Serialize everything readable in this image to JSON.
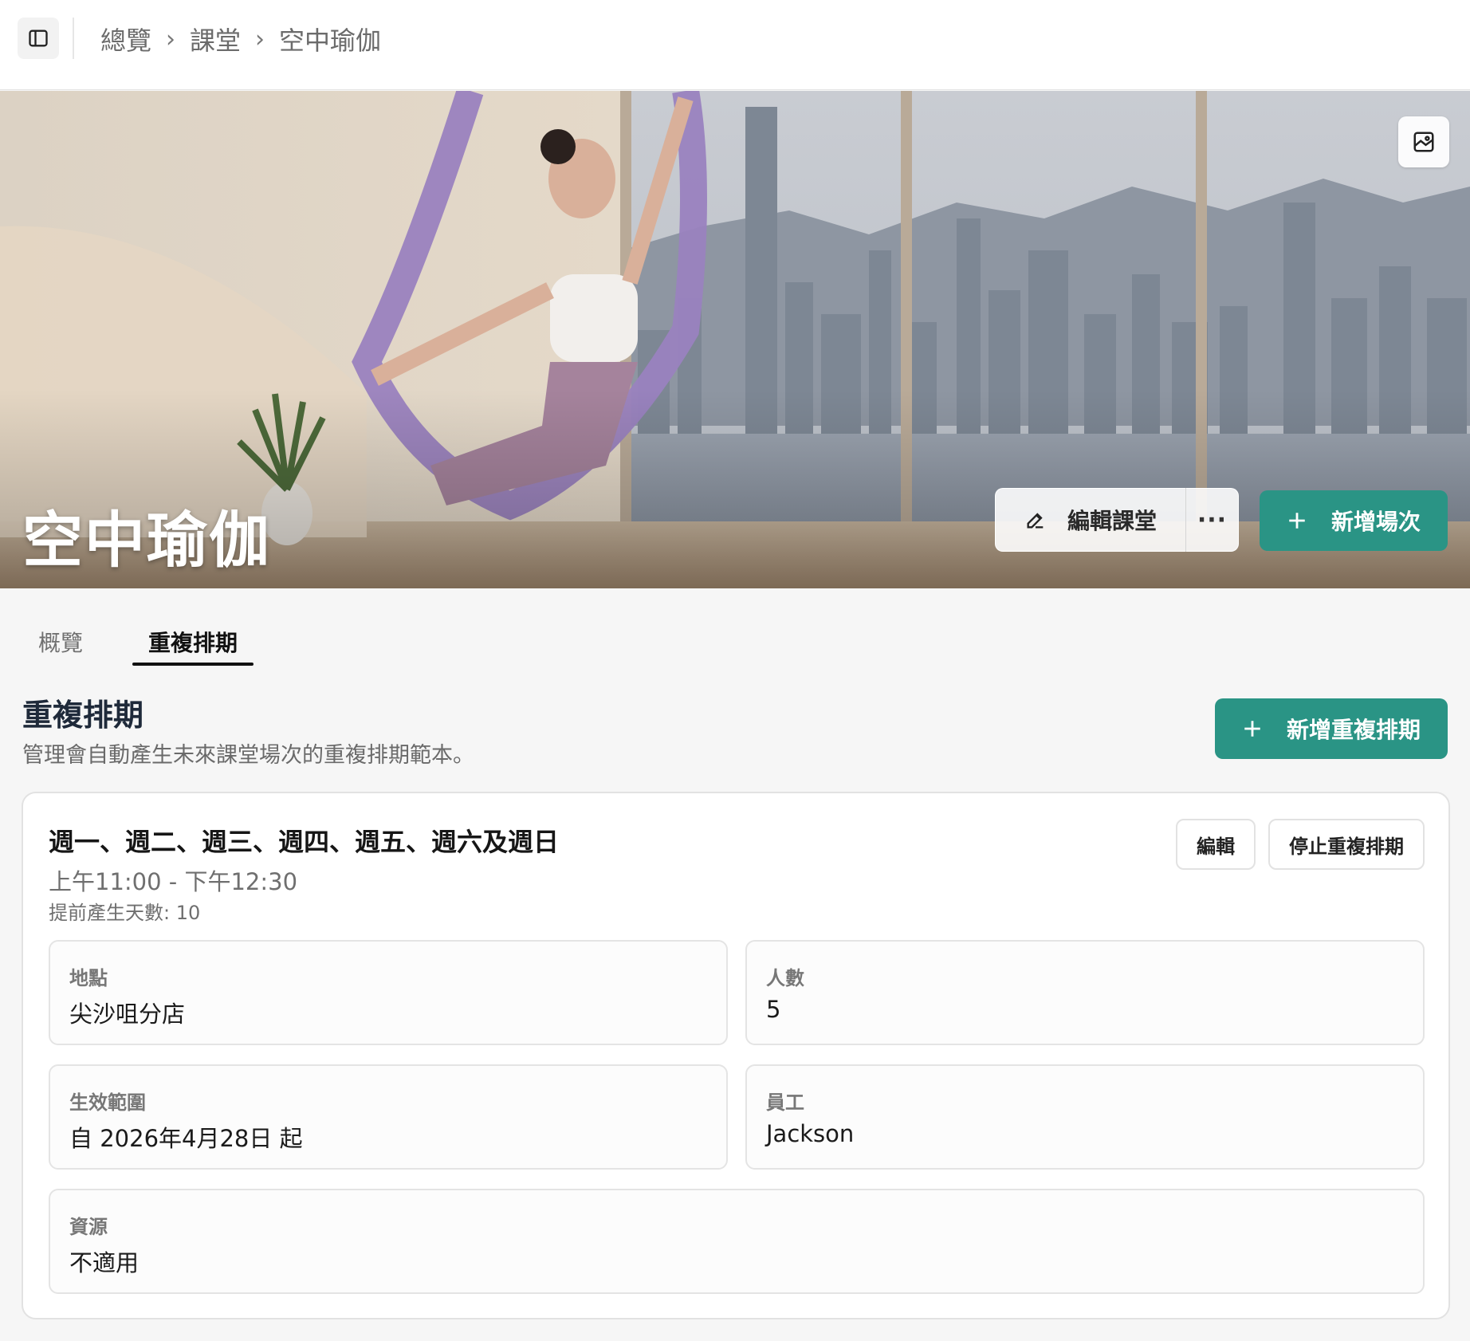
{
  "breadcrumb": {
    "items": [
      "總覽",
      "課堂",
      "空中瑜伽"
    ]
  },
  "hero": {
    "title": "空中瑜伽",
    "edit_label": "編輯課堂",
    "more_label": "···",
    "add_session_label": "新增場次"
  },
  "tabs": [
    {
      "label": "概覽"
    },
    {
      "label": "重複排期"
    }
  ],
  "section": {
    "title": "重複排期",
    "description": "管理會自動產生未來課堂場次的重複排期範本。",
    "add_label": "新增重複排期"
  },
  "schedule": {
    "days": "週一、週二、週三、週四、週五、週六及週日",
    "time": "上午11:00 - 下午12:30",
    "advance": "提前產生天數: 10",
    "edit_label": "編輯",
    "stop_label": "停止重複排期",
    "fields": {
      "location": {
        "label": "地點",
        "value": "尖沙咀分店"
      },
      "capacity": {
        "label": "人數",
        "value": "5"
      },
      "range": {
        "label": "生效範圍",
        "value": "自 2026年4月28日 起"
      },
      "staff": {
        "label": "員工",
        "value": "Jackson"
      },
      "resource": {
        "label": "資源",
        "value": "不適用"
      }
    }
  },
  "colors": {
    "accent": "#2a9485",
    "silk": "#9a82bf"
  }
}
